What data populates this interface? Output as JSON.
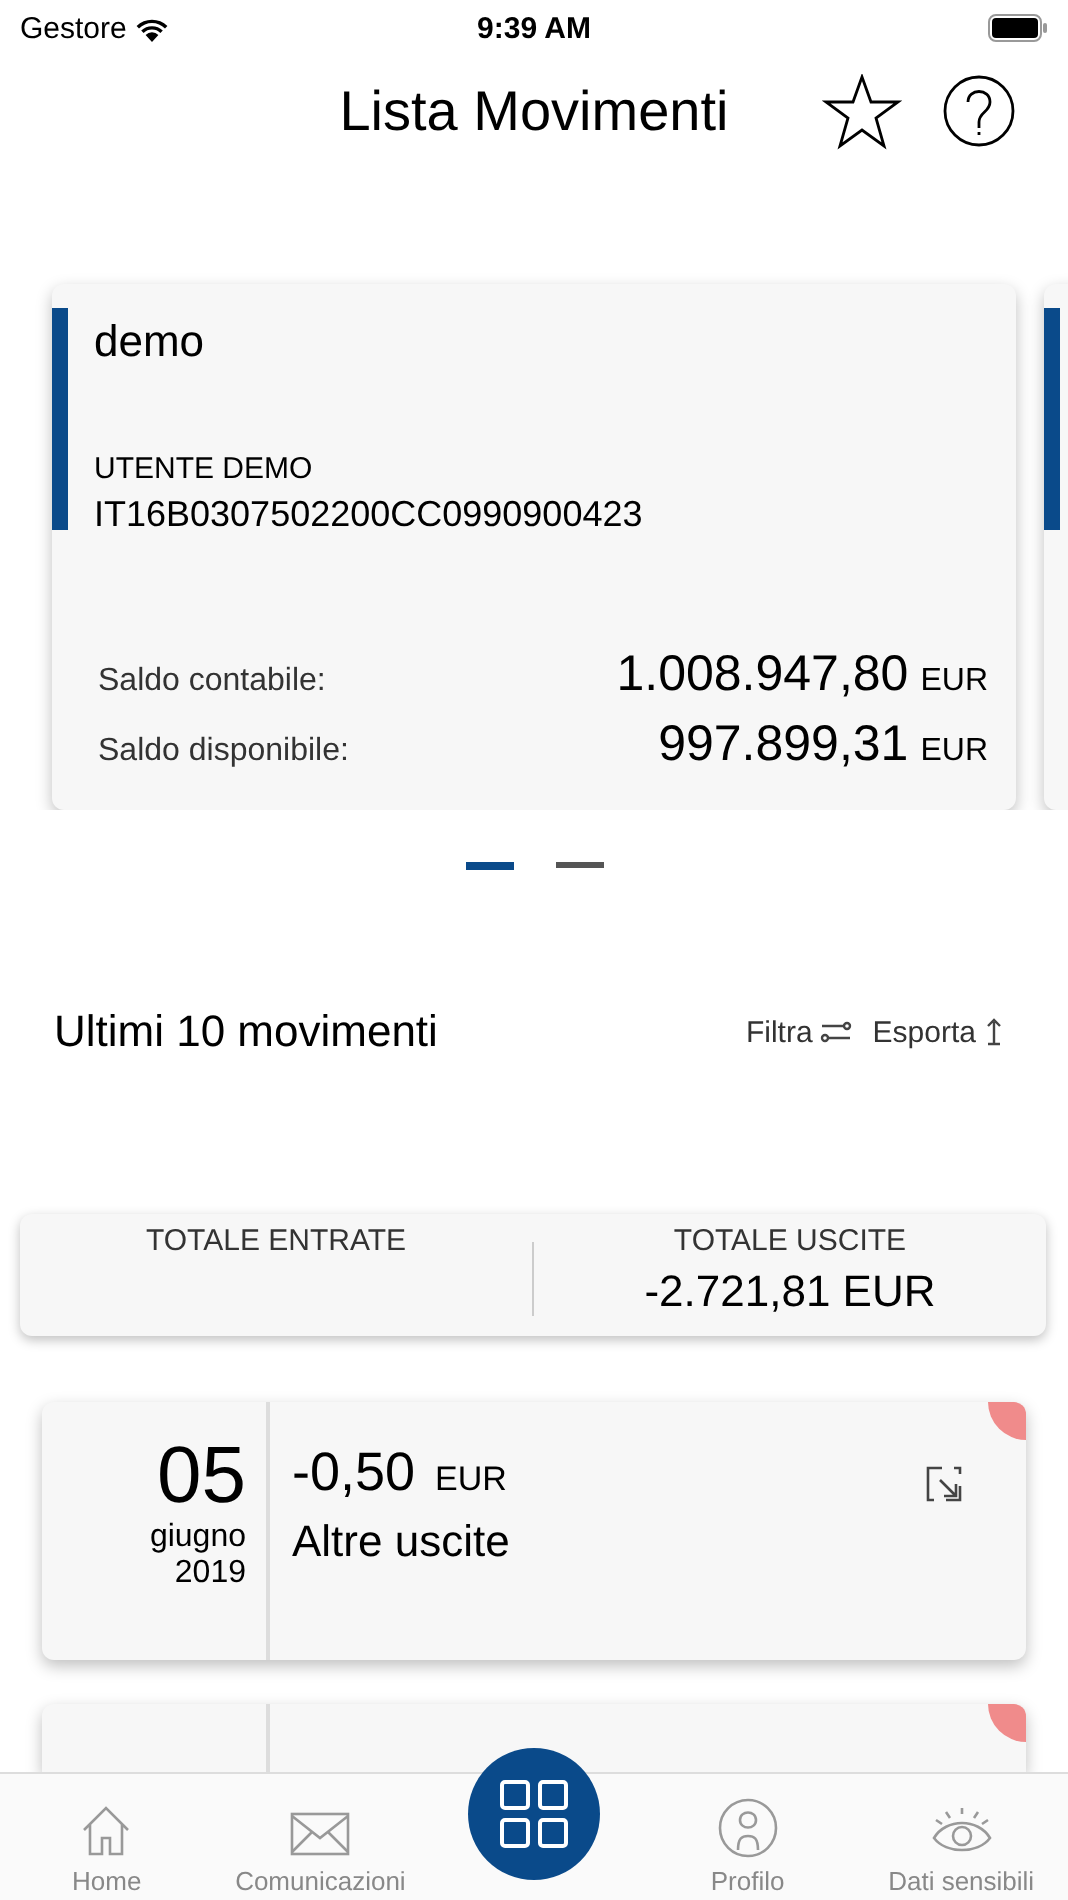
{
  "status_bar": {
    "carrier": "Gestore",
    "time": "9:39 AM"
  },
  "header": {
    "title": "Lista Movimenti"
  },
  "accounts": [
    {
      "name": "demo",
      "holder": "UTENTE DEMO",
      "iban": "IT16B0307502200CC0990900423",
      "balances": [
        {
          "label": "Saldo contabile:",
          "amount": "1.008.947,80",
          "currency": "EUR"
        },
        {
          "label": "Saldo disponibile:",
          "amount": "997.899,31",
          "currency": "EUR"
        }
      ]
    },
    {
      "kind": "peek"
    }
  ],
  "pager": [
    {
      "selected": true
    },
    {
      "selected": false
    }
  ],
  "section": {
    "title": "Ultimi 10 movimenti",
    "actions": [
      {
        "label": "Filtra",
        "kind": "filter"
      },
      {
        "label": "Esporta",
        "kind": "export"
      }
    ]
  },
  "totals": [
    {
      "label": "TOTALE ENTRATE"
    },
    {
      "label": "TOTALE USCITE",
      "value": "-2.721,81 EUR"
    }
  ],
  "movements": [
    {
      "day": "05",
      "month": "giugno",
      "year": "2019",
      "amount": "-0,50",
      "currency": "EUR",
      "category": "Altre uscite",
      "color": "#f08b8b"
    },
    {
      "kind": "cut",
      "color": "#f08b8b"
    }
  ],
  "tab_bar": [
    {
      "label": "Home",
      "kind": "home"
    },
    {
      "label": "Comunicazioni",
      "kind": "mail"
    },
    {
      "kind": "center"
    },
    {
      "label": "Profilo",
      "kind": "profile"
    },
    {
      "label": "Dati sensibili",
      "kind": "eye"
    }
  ]
}
